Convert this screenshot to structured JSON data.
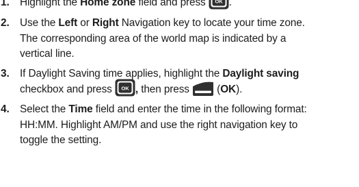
{
  "steps": [
    {
      "number": "1.",
      "l1_a": "Highlight the ",
      "l1_b": "Home zone",
      "l1_c": " field and press ",
      "l1_d": "."
    },
    {
      "number": "2.",
      "l1_a": "Use the ",
      "l1_b": "Left",
      "l1_c": " or ",
      "l1_d": "Right",
      "l1_e": " Navigation key to locate your time zone.",
      "l2": "The corresponding area of the world map is indicated by a",
      "l3": "vertical line."
    },
    {
      "number": "3.",
      "l1_a": "If Daylight Saving time applies, highlight the ",
      "l1_b": "Daylight saving",
      "l2_a": "checkbox and press ",
      "l2_b": ",",
      "l2_c": " then press ",
      "l2_d": " (",
      "l2_e": "OK",
      "l2_f": ")."
    },
    {
      "number": "4.",
      "l1_a": "Select the ",
      "l1_b": "Time",
      "l1_c": " field and enter the time in the following format:",
      "l2": "HH:MM. Highlight AM/PM and use the right navigation key to",
      "l3": "toggle the setting."
    }
  ],
  "ok_key_label": "OK",
  "icons": {
    "ok_key": "ok-key-icon",
    "soft_key": "left-soft-key-icon"
  },
  "colors": {
    "text": "#1c1c1c",
    "key_body": "#303030",
    "key_face": "#ffffff"
  }
}
